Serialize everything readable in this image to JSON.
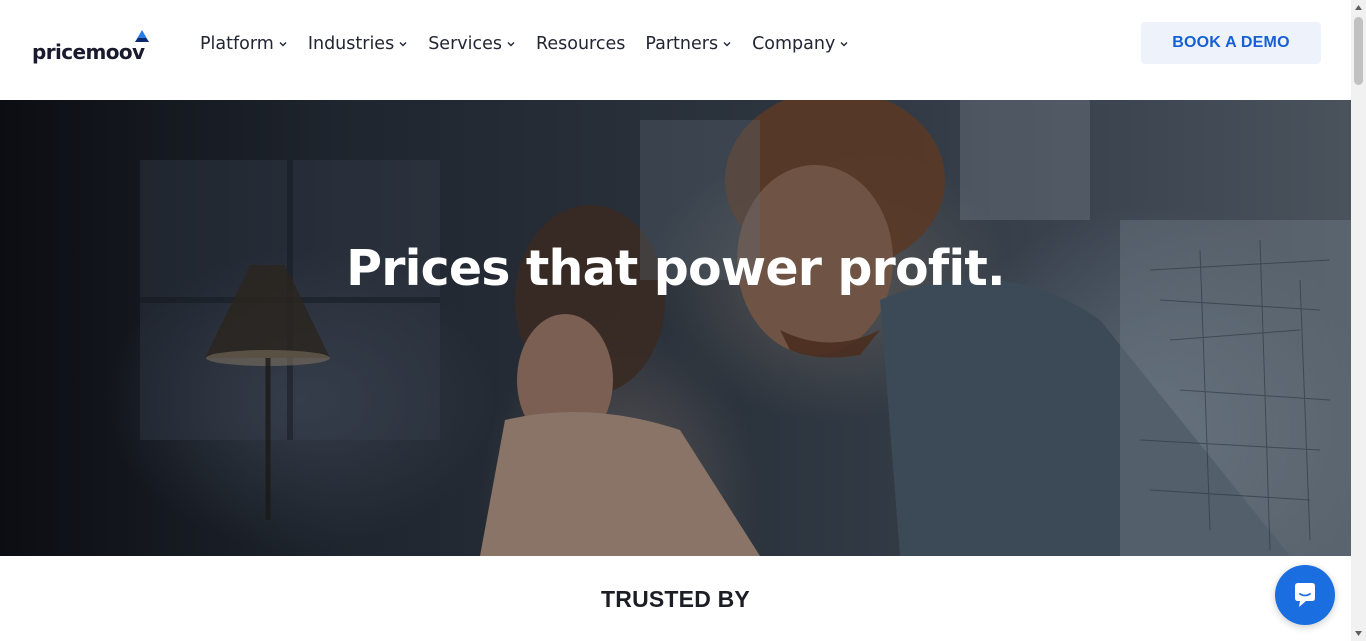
{
  "brand": {
    "name": "pricemoov",
    "accent": "#1560d4"
  },
  "nav": {
    "items": [
      {
        "label": "Platform",
        "has_dropdown": true
      },
      {
        "label": "Industries",
        "has_dropdown": true
      },
      {
        "label": "Services",
        "has_dropdown": true
      },
      {
        "label": "Resources",
        "has_dropdown": false
      },
      {
        "label": "Partners",
        "has_dropdown": true
      },
      {
        "label": "Company",
        "has_dropdown": true
      }
    ]
  },
  "header": {
    "cta_label": "BOOK A DEMO"
  },
  "hero": {
    "headline": "Prices that power profit."
  },
  "trusted": {
    "heading": "TRUSTED BY"
  },
  "chat": {
    "icon": "chat-bubble-icon",
    "color": "#1a6ee0"
  }
}
